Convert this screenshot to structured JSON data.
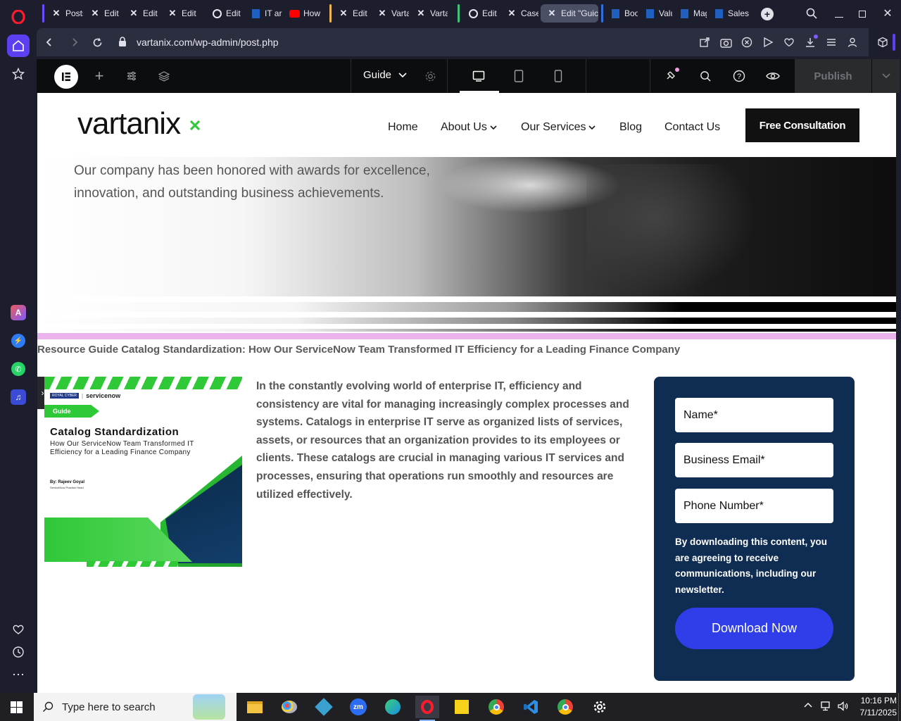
{
  "browser": {
    "tabs": [
      {
        "label": "Posts",
        "icon": "x-icon"
      },
      {
        "label": "Edit I",
        "icon": "x-icon"
      },
      {
        "label": "Edit",
        "icon": "x-icon"
      },
      {
        "label": "Edit",
        "icon": "x-icon"
      },
      {
        "label": "Edit",
        "icon": "wordpress-icon"
      },
      {
        "label": "IT ar",
        "icon": "doc-icon"
      },
      {
        "label": "How",
        "icon": "youtube-icon"
      },
      {
        "label": "Edit",
        "icon": "x-icon"
      },
      {
        "label": "Varta",
        "icon": "x-icon"
      },
      {
        "label": "Varta",
        "icon": "x-icon"
      },
      {
        "label": "Edit",
        "icon": "wordpress-icon"
      },
      {
        "label": "Case",
        "icon": "x-icon"
      },
      {
        "label": "Edit \"Guic",
        "icon": "x-icon"
      },
      {
        "label": "Boo",
        "icon": "doc-icon"
      },
      {
        "label": "Valu",
        "icon": "doc-icon"
      },
      {
        "label": "Mag",
        "icon": "doc-icon"
      },
      {
        "label": "Sales",
        "icon": "doc-icon"
      }
    ],
    "url": "vartanix.com/wp-admin/post.php"
  },
  "editor": {
    "page_dropdown": "Guide",
    "publish_label": "Publish"
  },
  "site": {
    "logo": "vartanix",
    "nav": [
      "Home",
      "About Us",
      "Our Services",
      "Blog",
      "Contact Us"
    ],
    "cta": "Free Consultation"
  },
  "hero": {
    "text": "Our company has been honored with awards for excellence, innovation, and outstanding business achievements."
  },
  "article": {
    "heading_part1": "Resource Guide Catalog Standardization",
    "heading_part2": ": How Our ServiceNow Team Transformed IT Efficiency for a Leading Finance Company",
    "body": "In the constantly evolving world of enterprise IT, efficiency and consistency are vital for managing increasingly complex processes and systems. Catalogs in enterprise IT serve as organized lists of services, assets, or resources that an organization provides to its employees or clients. These catalogs are crucial in managing various IT services and processes, ensuring that operations run smoothly and resources are utilized effectively."
  },
  "cover": {
    "brand1": "ROYAL CYBER",
    "brand2": "servicenow",
    "tag": "Guide",
    "title": "Catalog Standardization",
    "subtitle": "How Our ServiceNow Team Transformed IT Efficiency for a Leading Finance Company",
    "author": "By: Rajeev Goyal",
    "author_role": "ServiceNow Practice Head"
  },
  "form": {
    "name": "Name*",
    "email": "Business Email*",
    "phone": "Phone Number*",
    "consent": "By downloading this content, you are agreeing to receive communications, including our newsletter.",
    "button": "Download Now"
  },
  "taskbar": {
    "search_placeholder": "Type here to search",
    "time": "10:16 PM",
    "date": "7/11/2025"
  },
  "colors": {
    "elementor_bg": "#0c0d0e",
    "cta_bg": "#111111",
    "form_bg": "#0f2d52",
    "download_btn": "#2f3ee8",
    "accent_green": "#2fc837"
  }
}
